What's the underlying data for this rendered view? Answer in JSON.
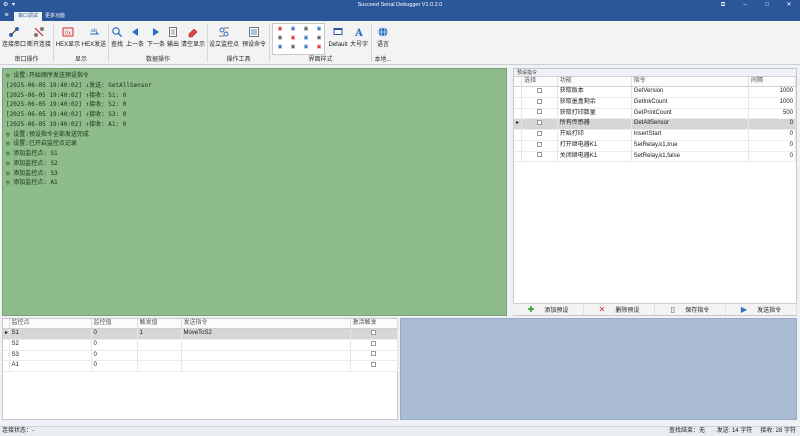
{
  "window": {
    "title": "Succeed Serial Debugger  V1.0.2.0",
    "minimize": "–",
    "maximize": "□",
    "close": "✕",
    "restore": "⧉"
  },
  "tabs": [
    {
      "label": "串口调试",
      "active": true
    },
    {
      "label": "更多功能",
      "active": false
    }
  ],
  "ribbon": {
    "connect": "连接串口",
    "disconnect": "断开连接",
    "hex_display": "HEX显示",
    "hex_send": "HEX发送",
    "search": "查找",
    "prev": "上一条",
    "next": "下一条",
    "output": "输出",
    "clear": "清空显示",
    "set_monitor": "设立监控点",
    "preset_cmd": "预设命令",
    "theme_value": "Default",
    "big_font": "大号字",
    "language": "语言",
    "groups": {
      "serial": "串口操作",
      "display": "显示",
      "data": "数据操作",
      "tools": "操作工具",
      "ui_style": "界面样式",
      "local": "本地..."
    }
  },
  "log": [
    "◎ 设置:开始顺序发送预设指令",
    "[2025-06-05 19:40:02] ↓发送: GetAllSensor",
    "[2025-06-05 19:40:02] ↑接收: S1: 0",
    "[2025-06-05 19:40:02] ↑接收: S2: 0",
    "[2025-06-05 19:40:02] ↑接收: S3: 0",
    "[2025-06-05 19:40:02] ↑接收: A1: 0",
    "◎ 设置:预设指令全部发送完成",
    "◎ 设置:已开启监控点记录",
    "◎ 添加监控点: S1",
    "◎ 添加监控点: S2",
    "◎ 添加监控点: S3",
    "◎ 添加监控点: A1"
  ],
  "preset": {
    "title": "预设指令",
    "columns": [
      "选择",
      "功能",
      "指令",
      "间隔"
    ],
    "rows": [
      {
        "marker": "",
        "checked": false,
        "func": "获取版本",
        "cmd": "GetVersion",
        "interval": "1000",
        "selected": false
      },
      {
        "marker": "",
        "checked": false,
        "func": "获取墨盒剩余",
        "cmd": "GetInkCount",
        "interval": "1000",
        "selected": false
      },
      {
        "marker": "",
        "checked": false,
        "func": "获取打印数量",
        "cmd": "GetPrintCount",
        "interval": "500",
        "selected": false
      },
      {
        "marker": "▸",
        "checked": true,
        "func": "所有传感器",
        "cmd": "GetAllSensor",
        "interval": "0",
        "selected": true
      },
      {
        "marker": "",
        "checked": false,
        "func": "开始打印",
        "cmd": "InsertStart",
        "interval": "0",
        "selected": false
      },
      {
        "marker": "",
        "checked": false,
        "func": "打开继电器K1",
        "cmd": "SetRelay,k1,true",
        "interval": "0",
        "selected": false
      },
      {
        "marker": "",
        "checked": false,
        "func": "关闭继电器K1",
        "cmd": "SetRelay,k1,false",
        "interval": "0",
        "selected": false
      }
    ],
    "buttons": {
      "add": "添加预设",
      "delete": "删除预设",
      "save": "保存指令",
      "send": "发送指令"
    }
  },
  "monitor": {
    "columns": [
      "监控点",
      "监控值",
      "触发值",
      "发送指令",
      "激活触发"
    ],
    "rows": [
      {
        "marker": "▸",
        "point": "S1",
        "value": "0",
        "trigger": "1",
        "cmd": "MoveToS2",
        "active": true,
        "selected": true
      },
      {
        "marker": "",
        "point": "S2",
        "value": "0",
        "trigger": "",
        "cmd": "",
        "active": false,
        "selected": false
      },
      {
        "marker": "",
        "point": "S3",
        "value": "0",
        "trigger": "",
        "cmd": "",
        "active": false,
        "selected": false
      },
      {
        "marker": "",
        "point": "A1",
        "value": "0",
        "trigger": "",
        "cmd": "",
        "active": false,
        "selected": false
      }
    ]
  },
  "status": {
    "connection": "连接状态：-",
    "search": "查找结束：无",
    "send": "· 发送: 14 字符",
    "receive": "接收: 28 字符"
  },
  "colors": {
    "titlebar": "#2b579a",
    "log_bg": "#8fbc8b",
    "blue_panel": "#aabbd5",
    "add_icon": "#2e9b3a",
    "delete_icon": "#d22b2b",
    "send_icon": "#2b6cc4"
  }
}
